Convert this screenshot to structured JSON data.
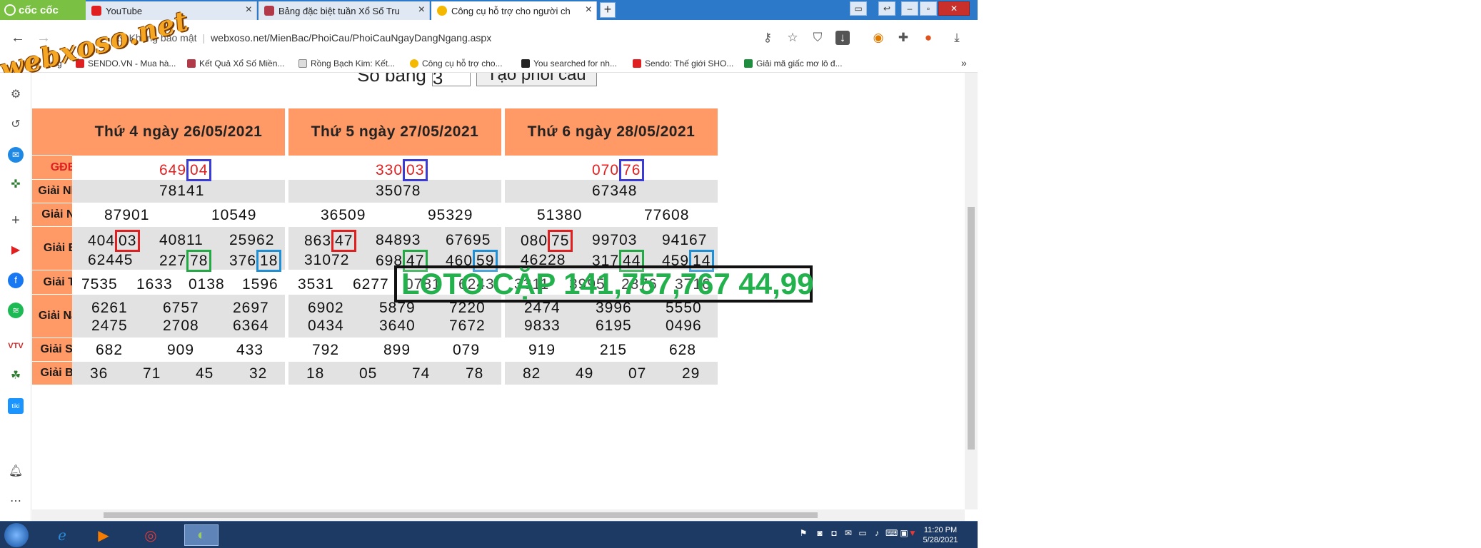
{
  "browser": {
    "brand": "cốc cốc",
    "tabs": [
      {
        "title": "YouTube",
        "icon_color": "#e02020"
      },
      {
        "title": "Bảng đặc biệt tuần Xổ Số Tru",
        "icon_color": "#b23a48"
      },
      {
        "title": "Công cụ hỗ trợ cho người ch",
        "icon_color": "#f5b800",
        "active": true
      }
    ],
    "new_tab": "+",
    "security_label": "Không bảo mật",
    "url": "webxoso.net/MienBac/PhoiCau/PhoiCauNgayDangNgang.aspx",
    "watermark": "webxoso.net",
    "bookmarks": [
      "dụng",
      "SENDO.VN - Mua hà...",
      "Kết Quả Xổ Số Miền...",
      "Rồng Bạch Kim: Kết...",
      "Công cụ hỗ trợ cho...",
      "You searched for nh...",
      "Sendo: Thế giới SHO...",
      "Giải mã giấc mơ lô đ..."
    ],
    "bookmark_overflow": "»"
  },
  "page": {
    "top_label": "Số bảng",
    "top_input_value": "3",
    "top_button": "Tạo phôi cầu",
    "overlay_text": "LOTO CẶP 141,757,767 44,99",
    "row_labels": [
      "GĐB",
      "Giải Nhất",
      "Giải Nhì",
      "Giải Ba",
      "Giải Tư",
      "Giải Năm",
      "Giải Sáu",
      "Giải Bảy"
    ],
    "days": [
      {
        "header": "Thứ 4 ngày 26/05/2021",
        "gdb": {
          "prefix": "649",
          "box": "04"
        },
        "nhat": "78141",
        "nhi": [
          "87901",
          "10549"
        ],
        "ba": [
          {
            "prefix": "404",
            "box": "03",
            "color": "red"
          },
          {
            "text": "40811"
          },
          {
            "text": "25962"
          },
          {
            "text": "62445"
          },
          {
            "prefix": "227",
            "box": "78",
            "color": "green"
          },
          {
            "prefix": "376",
            "box": "18",
            "color": "blue"
          }
        ],
        "tu": [
          "7535",
          "1633",
          "0138",
          "1596"
        ],
        "nam": [
          "6261",
          "6757",
          "2697",
          "2475",
          "2708",
          "6364"
        ],
        "sau": [
          "682",
          "909",
          "433"
        ],
        "bay": [
          "36",
          "71",
          "45",
          "32"
        ]
      },
      {
        "header": "Thứ 5 ngày 27/05/2021",
        "gdb": {
          "prefix": "330",
          "box": "03"
        },
        "nhat": "35078",
        "nhi": [
          "36509",
          "95329"
        ],
        "ba": [
          {
            "prefix": "863",
            "box": "47",
            "color": "red"
          },
          {
            "text": "84893"
          },
          {
            "text": "67695"
          },
          {
            "text": "31072"
          },
          {
            "prefix": "698",
            "box": "47",
            "color": "green"
          },
          {
            "prefix": "460",
            "box": "59",
            "color": "blue"
          }
        ],
        "tu": [
          "3531",
          "6277",
          "0781",
          "6243"
        ],
        "nam": [
          "6902",
          "5879",
          "7220",
          "0434",
          "3640",
          "7672"
        ],
        "sau": [
          "792",
          "899",
          "079"
        ],
        "bay": [
          "18",
          "05",
          "74",
          "78"
        ]
      },
      {
        "header": "Thứ 6 ngày 28/05/2021",
        "gdb": {
          "prefix": "070",
          "box": "76"
        },
        "nhat": "67348",
        "nhi": [
          "51380",
          "77608"
        ],
        "ba": [
          {
            "prefix": "080",
            "box": "75",
            "color": "red"
          },
          {
            "text": "99703"
          },
          {
            "text": "94167"
          },
          {
            "text": "46228"
          },
          {
            "prefix": "317",
            "box": "44",
            "color": "green"
          },
          {
            "prefix": "459",
            "box": "14",
            "color": "blue"
          }
        ],
        "tu": [
          "3311",
          "3995",
          "2876",
          "3716"
        ],
        "nam": [
          "2474",
          "3996",
          "5550",
          "9833",
          "6195",
          "0496"
        ],
        "sau": [
          "919",
          "215",
          "628"
        ],
        "bay": [
          "82",
          "49",
          "07",
          "29"
        ]
      }
    ]
  },
  "taskbar": {
    "time": "11:20 PM",
    "date": "5/28/2021"
  },
  "colors": {
    "header_bg": "#ff9966",
    "row_alt": "#e2e2e2",
    "special_red": "#e02020",
    "box_red": "#e02020",
    "box_green": "#22aa44",
    "box_blue": "#1e90d6",
    "box_violet": "#3b3bd6",
    "overlay_green": "#22b14c"
  }
}
